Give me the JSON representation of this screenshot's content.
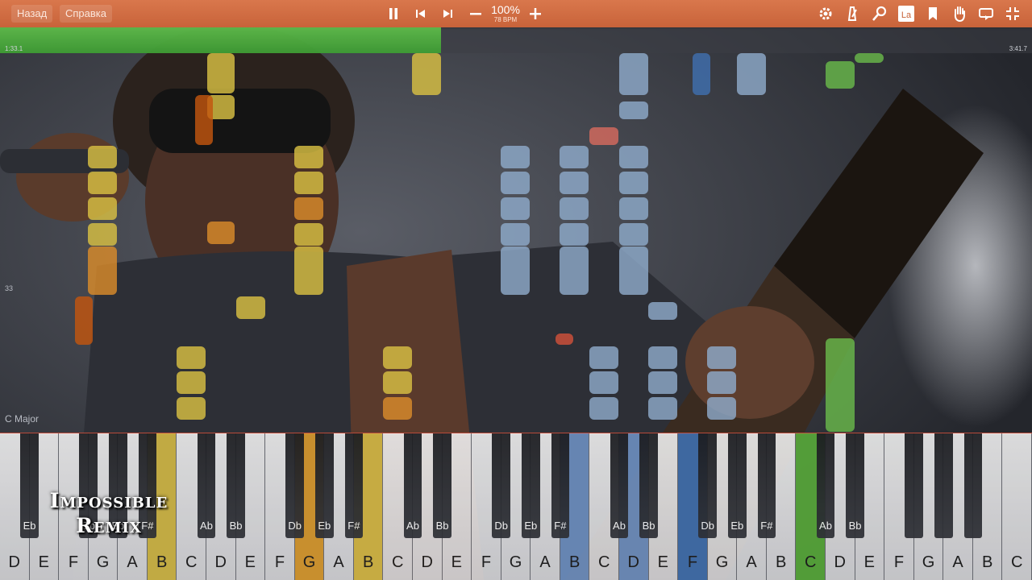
{
  "toolbar": {
    "back_label": "Назад",
    "help_label": "Справка",
    "speed_percent": "100%",
    "bpm": "78 BPM",
    "left_icons": [
      "pause-icon",
      "skip-back-icon",
      "skip-forward-icon",
      "minus-icon"
    ],
    "right_icons": [
      "gear-icon",
      "metronome-icon",
      "zoom-icon",
      "label-icon",
      "bookmark-icon",
      "hand-icon",
      "loop-icon",
      "fullscreen-icon"
    ],
    "label_icon_text": "La"
  },
  "progress": {
    "elapsed": "1:33.1",
    "total": "3:41.7",
    "fraction": 0.427,
    "color": "#4caf3a"
  },
  "roll": {
    "measure_number": "33",
    "key_signature": "C Major"
  },
  "keyboard": {
    "white_keys": [
      "D",
      "E",
      "F",
      "G",
      "A",
      "B",
      "C",
      "D",
      "E",
      "F",
      "G",
      "A",
      "B",
      "C",
      "D",
      "E",
      "F",
      "G",
      "A",
      "B",
      "C",
      "D",
      "E",
      "F",
      "G",
      "A",
      "B",
      "C",
      "D",
      "E",
      "F",
      "G",
      "A",
      "B",
      "C"
    ],
    "black_key_labels": [
      "Eb",
      "Db",
      "Eb",
      "F#",
      "Ab",
      "Bb",
      "Db",
      "Eb",
      "F#",
      "Ab",
      "Bb",
      "Db",
      "Eb",
      "F#",
      "Ab",
      "Bb",
      "Db",
      "Eb",
      "F#",
      "Ab",
      "Bb"
    ],
    "highlighted": {
      "white": [
        {
          "index": 5,
          "color": "#d2b845"
        },
        {
          "index": 10,
          "color": "#d99a2e"
        },
        {
          "index": 12,
          "color": "#d2b845"
        },
        {
          "index": 19,
          "color": "#6d8fc0"
        },
        {
          "index": 21,
          "color": "#6d8fc0"
        },
        {
          "index": 23,
          "color": "#3f6fae"
        },
        {
          "index": 27,
          "color": "#58a93a"
        }
      ]
    }
  },
  "watermark": {
    "line1": "Impossible",
    "line2": "Remix"
  },
  "colors": {
    "yellow": "#d8bf43",
    "orange": "#d98b2b",
    "dark_orange": "#c2560f",
    "blue": "#8ea9c9",
    "dark_blue": "#3f6fae",
    "red": "#d66a5e",
    "green": "#69b84a"
  }
}
